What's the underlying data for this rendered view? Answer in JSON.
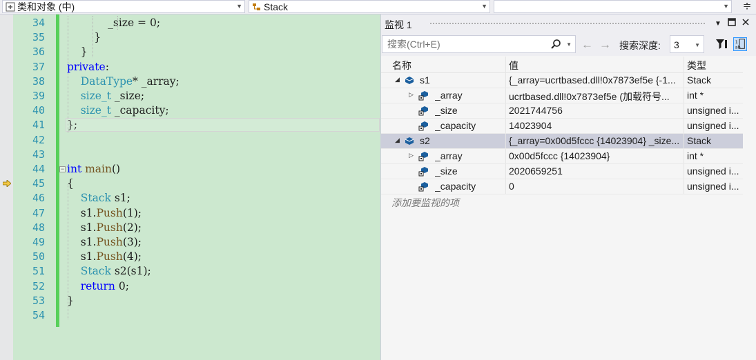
{
  "navbar": {
    "scope_combo": "类和对象 (中)",
    "type_combo": "Stack",
    "member_combo": ""
  },
  "editor": {
    "current_line": 45,
    "lines": [
      {
        "n": "34",
        "tokens": [
          {
            "t": "_size = 0;",
            "c": "tx"
          }
        ]
      },
      {
        "n": "35",
        "tokens": [
          {
            "t": "}",
            "c": "tx"
          }
        ]
      },
      {
        "n": "36",
        "tokens": [
          {
            "t": "}",
            "c": "tx"
          }
        ]
      },
      {
        "n": "37",
        "tokens": [
          {
            "t": "private",
            "c": "kw"
          },
          {
            "t": ":",
            "c": "tx"
          }
        ]
      },
      {
        "n": "38",
        "tokens": [
          {
            "t": "DataType",
            "c": "ty"
          },
          {
            "t": "* _array;",
            "c": "tx"
          }
        ]
      },
      {
        "n": "39",
        "tokens": [
          {
            "t": "size_t",
            "c": "ty"
          },
          {
            "t": " _size;",
            "c": "tx"
          }
        ]
      },
      {
        "n": "40",
        "tokens": [
          {
            "t": "size_t",
            "c": "ty"
          },
          {
            "t": " _capacity;",
            "c": "tx"
          }
        ]
      },
      {
        "n": "41",
        "tokens": [
          {
            "t": "};",
            "c": "tx"
          }
        ]
      },
      {
        "n": "42",
        "tokens": []
      },
      {
        "n": "43",
        "tokens": []
      },
      {
        "n": "44",
        "tokens": [
          {
            "t": "int",
            "c": "kw"
          },
          {
            "t": " ",
            "c": "tx"
          },
          {
            "t": "main",
            "c": "fn"
          },
          {
            "t": "()",
            "c": "tx"
          }
        ]
      },
      {
        "n": "45",
        "tokens": [
          {
            "t": "{",
            "c": "tx"
          }
        ]
      },
      {
        "n": "46",
        "tokens": [
          {
            "t": "Stack",
            "c": "ty"
          },
          {
            "t": " s1;",
            "c": "tx"
          }
        ]
      },
      {
        "n": "47",
        "tokens": [
          {
            "t": "s1.",
            "c": "tx"
          },
          {
            "t": "Push",
            "c": "fn"
          },
          {
            "t": "(1);",
            "c": "tx"
          }
        ]
      },
      {
        "n": "48",
        "tokens": [
          {
            "t": "s1.",
            "c": "tx"
          },
          {
            "t": "Push",
            "c": "fn"
          },
          {
            "t": "(2);",
            "c": "tx"
          }
        ]
      },
      {
        "n": "49",
        "tokens": [
          {
            "t": "s1.",
            "c": "tx"
          },
          {
            "t": "Push",
            "c": "fn"
          },
          {
            "t": "(3);",
            "c": "tx"
          }
        ]
      },
      {
        "n": "50",
        "tokens": [
          {
            "t": "s1.",
            "c": "tx"
          },
          {
            "t": "Push",
            "c": "fn"
          },
          {
            "t": "(4);",
            "c": "tx"
          }
        ]
      },
      {
        "n": "51",
        "tokens": [
          {
            "t": "Stack",
            "c": "ty"
          },
          {
            "t": " s2(s1);",
            "c": "tx"
          }
        ]
      },
      {
        "n": "52",
        "tokens": [
          {
            "t": "return",
            "c": "kw"
          },
          {
            "t": " 0;",
            "c": "tx"
          }
        ]
      },
      {
        "n": "53",
        "tokens": [
          {
            "t": "}",
            "c": "tx"
          }
        ]
      },
      {
        "n": "54",
        "tokens": []
      }
    ]
  },
  "watch": {
    "title": "监视 1",
    "search_placeholder": "搜索(Ctrl+E)",
    "depth_label": "搜索深度:",
    "depth_value": "3",
    "columns": [
      "名称",
      "值",
      "类型"
    ],
    "rows": [
      {
        "name": "s1",
        "value": "{_array=ucrtbased.dll!0x7873ef5e {-1...",
        "type": "Stack",
        "level": 0,
        "expander": "expanded",
        "icon": "object-icon",
        "selected": false
      },
      {
        "name": "_array",
        "value": "ucrtbased.dll!0x7873ef5e (加载符号...",
        "type": "int *",
        "level": 1,
        "expander": "collapsed",
        "icon": "field-icon",
        "selected": false
      },
      {
        "name": "_size",
        "value": "2021744756",
        "type": "unsigned i...",
        "level": 1,
        "expander": "none",
        "icon": "field-icon",
        "selected": false
      },
      {
        "name": "_capacity",
        "value": "14023904",
        "type": "unsigned i...",
        "level": 1,
        "expander": "none",
        "icon": "field-icon",
        "selected": false
      },
      {
        "name": "s2",
        "value": "{_array=0x00d5fccc {14023904} _size...",
        "type": "Stack",
        "level": 0,
        "expander": "expanded",
        "icon": "object-icon",
        "selected": true
      },
      {
        "name": "_array",
        "value": "0x00d5fccc {14023904}",
        "type": "int *",
        "level": 1,
        "expander": "collapsed",
        "icon": "field-icon",
        "selected": false
      },
      {
        "name": "_size",
        "value": "2020659251",
        "type": "unsigned i...",
        "level": 1,
        "expander": "none",
        "icon": "field-icon",
        "selected": false
      },
      {
        "name": "_capacity",
        "value": "0",
        "type": "unsigned i...",
        "level": 1,
        "expander": "none",
        "icon": "field-icon",
        "selected": false
      }
    ],
    "add_item_text": "添加要监视的项"
  }
}
